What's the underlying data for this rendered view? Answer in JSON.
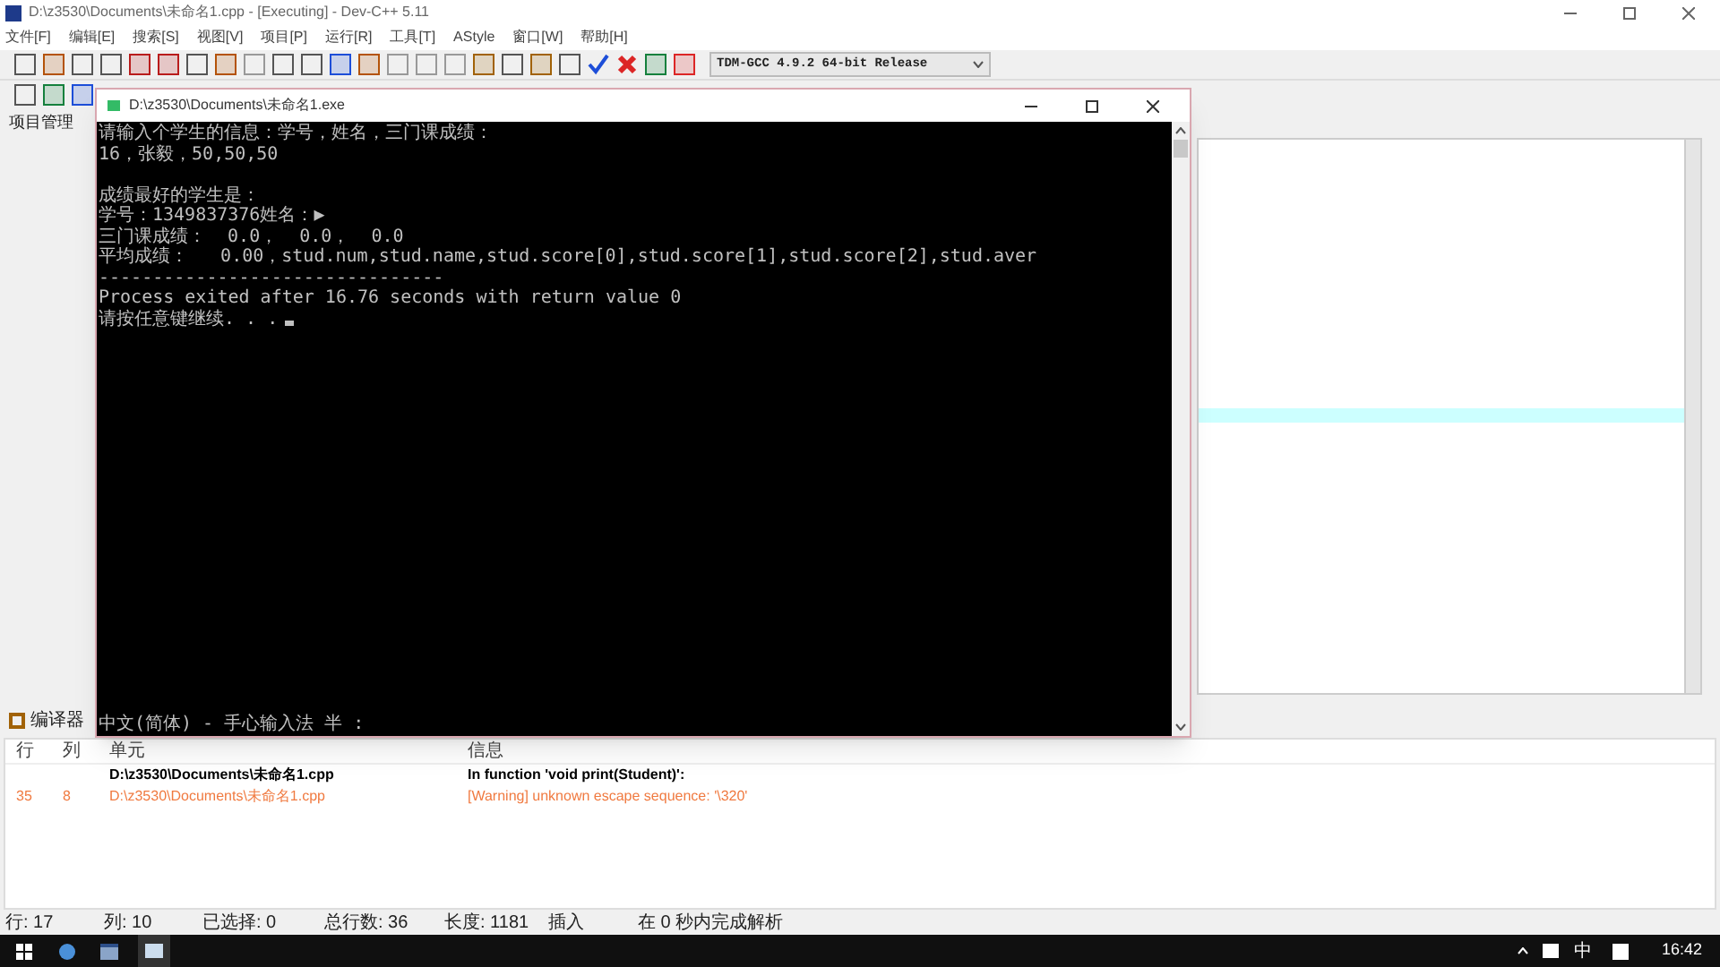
{
  "window": {
    "title": "D:\\z3530\\Documents\\未命名1.cpp - [Executing] - Dev-C++ 5.11"
  },
  "menu": [
    "文件[F]",
    "编辑[E]",
    "搜索[S]",
    "视图[V]",
    "项目[P]",
    "运行[R]",
    "工具[T]",
    "AStyle",
    "窗口[W]",
    "帮助[H]"
  ],
  "compiler_select": {
    "value": "TDM-GCC 4.9.2 64-bit Release"
  },
  "left_panel": {
    "tab": "项目管理"
  },
  "bottom_panel": {
    "tab": "编译器",
    "columns": [
      "行",
      "列",
      "单元",
      "信息"
    ],
    "rows": [
      {
        "kind": "header",
        "cells": [
          "",
          "",
          "D:\\z3530\\Documents\\未命名1.cpp",
          "In function 'void print(Student)':"
        ]
      },
      {
        "kind": "warning",
        "cells": [
          "35",
          "8",
          "D:\\z3530\\Documents\\未命名1.cpp",
          "[Warning] unknown escape sequence: '\\320'"
        ]
      }
    ]
  },
  "status_bar": [
    {
      "label": "行:",
      "value": "17"
    },
    {
      "label": "列:",
      "value": "10"
    },
    {
      "label": "已选择:",
      "value": "0"
    },
    {
      "label": "总行数:",
      "value": "36"
    },
    {
      "label": "长度:",
      "value": "1181"
    },
    {
      "label": "插入"
    },
    {
      "label": "在 0 秒内完成解析"
    }
  ],
  "console": {
    "title": "D:\\z3530\\Documents\\未命名1.exe",
    "blocks": [
      [
        "请输入个学生的信息：学号，姓名，三门课成绩：",
        "16，张毅，50,50,50"
      ],
      [
        "成绩最好的学生是：",
        "学号：1349837376姓名：▶",
        "三门课成绩：  0.0，  0.0，  0.0",
        "平均成绩：   0.00，stud.num,stud.name,stud.score[0],stud.score[1],stud.score[2],stud.aver",
        "--------------------------------",
        "Process exited after 16.76 seconds with return value 0",
        "请按任意键继续. . ."
      ]
    ],
    "ime_status": "中文(简体) - 手心输入法 半 :"
  },
  "taskbar": {
    "ime": "中",
    "clock": "16:42"
  }
}
